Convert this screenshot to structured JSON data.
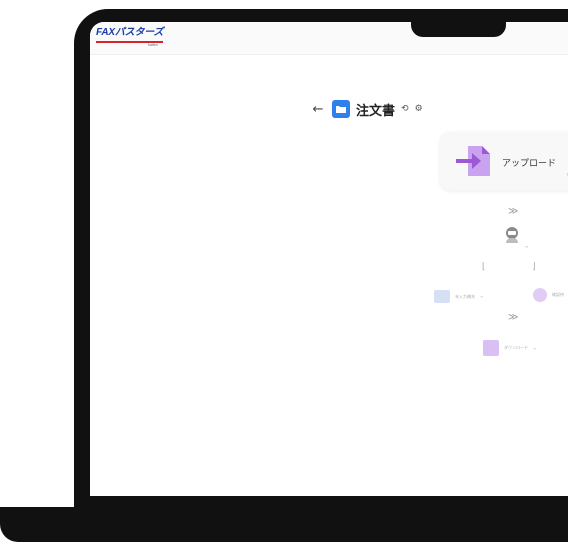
{
  "app": {
    "logo_text": "FAXパスターズ",
    "logo_sub": "batten",
    "brand_colors": {
      "logo_blue": "#1b3ca8",
      "logo_red": "#d8232a",
      "accent_purple": "#9b59d6"
    }
  },
  "page": {
    "title": "注文書",
    "back_icon": "arrow-left-icon",
    "history_icon": "history-icon",
    "settings_icon": "gear-icon"
  },
  "flow": {
    "upload": {
      "label": "アップロード",
      "icon": "upload-arrow-icon",
      "note": "≡"
    },
    "robot": {
      "icon": "robot-icon",
      "sub": "≡"
    },
    "branches": [
      {
        "label": "未入力補充",
        "sub": "≡",
        "icon": "edit-icon"
      },
      {
        "label": "確認待",
        "sub": "",
        "icon": "alert-icon"
      }
    ],
    "download": {
      "label": "ダウンロード",
      "sub": "≡",
      "icon": "download-check-icon"
    }
  }
}
